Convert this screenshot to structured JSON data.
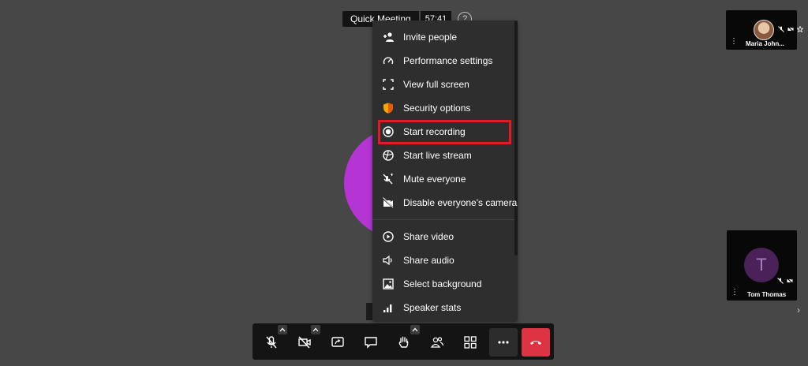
{
  "meeting": {
    "title": "Quick Meeting",
    "timer": "57:41"
  },
  "menu": {
    "items": [
      {
        "label": "Invite people",
        "icon": "invite-people-icon"
      },
      {
        "label": "Performance settings",
        "icon": "gauge-icon"
      },
      {
        "label": "View full screen",
        "icon": "fullscreen-icon"
      },
      {
        "label": "Security options",
        "icon": "shield-icon"
      },
      {
        "label": "Start recording",
        "icon": "record-icon"
      },
      {
        "label": "Start live stream",
        "icon": "live-stream-icon"
      },
      {
        "label": "Mute everyone",
        "icon": "mute-everyone-icon"
      },
      {
        "label": "Disable everyone's camera",
        "icon": "camera-off-icon"
      },
      {
        "label": "Share video",
        "icon": "play-icon"
      },
      {
        "label": "Share audio",
        "icon": "speaker-icon"
      },
      {
        "label": "Select background",
        "icon": "image-icon"
      },
      {
        "label": "Speaker stats",
        "icon": "bar-chart-icon"
      }
    ]
  },
  "participants": [
    {
      "name": "Maria John...",
      "initial": ""
    },
    {
      "name": "Tom Thomas",
      "initial": "T"
    }
  ],
  "colors": {
    "accent_security": "#f7a600",
    "hangup": "#dd3343",
    "highlight": "#e01b24",
    "avatar": "#b435d3"
  }
}
